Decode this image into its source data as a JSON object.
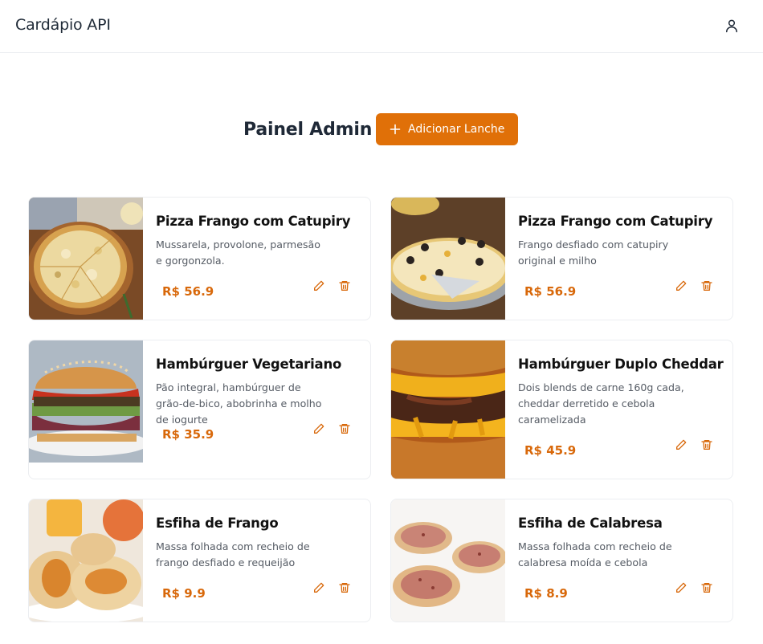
{
  "app": {
    "title": "Cardápio API"
  },
  "header": {
    "title": "Painel Admin",
    "add_button": "Adicionar Lanche"
  },
  "colors": {
    "accent": "#e07008",
    "price": "#d8680a"
  },
  "icons": {
    "user": "user-icon",
    "add": "plus-icon",
    "edit": "pencil-icon",
    "delete": "trash-icon"
  },
  "items": [
    {
      "name": "Pizza Frango com Catupiry",
      "description": "Mussarela, provolone, parmesão e gorgonzola.",
      "price": "R$ 56.9",
      "image": "pizza"
    },
    {
      "name": "Pizza Frango com Catupiry",
      "description": "Frango desfiado com catupiry original e milho",
      "price": "R$ 56.9",
      "image": "pizza-olive"
    },
    {
      "name": "Hambúrguer Vegetariano",
      "description": "Pão integral, hambúrguer de grão-de-bico, abobrinha e molho de iogurte",
      "price": "R$ 35.9",
      "image": "veggie-burger"
    },
    {
      "name": "Hambúrguer Duplo Cheddar",
      "description": "Dois blends de carne 160g cada, cheddar derretido e cebola caramelizada",
      "price": "R$ 45.9",
      "image": "cheddar-burger"
    },
    {
      "name": "Esfiha de Frango",
      "description": "Massa folhada com recheio de frango desfiado e requeijão",
      "price": "R$ 9.9",
      "image": "esfiha-frango"
    },
    {
      "name": "Esfiha de Calabresa",
      "description": "Massa folhada com recheio de calabresa moída e cebola",
      "price": "R$ 8.9",
      "image": "esfiha-calabresa"
    }
  ]
}
